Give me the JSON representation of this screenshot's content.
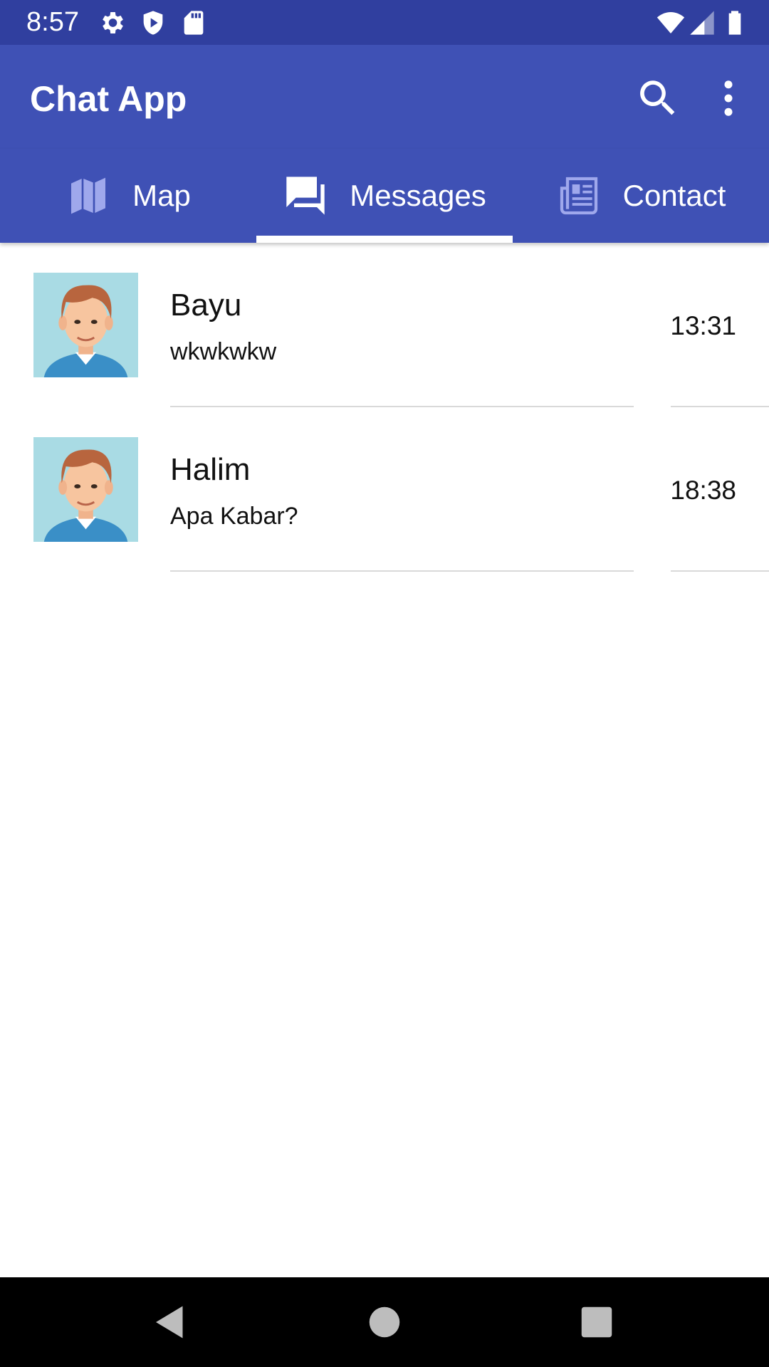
{
  "status_bar": {
    "time": "8:57",
    "icons": [
      "settings-icon",
      "shield-icon",
      "sd-card-icon",
      "wifi-icon",
      "signal-icon",
      "battery-icon"
    ]
  },
  "app_bar": {
    "title": "Chat App",
    "actions": [
      "search-icon",
      "more-vert-icon"
    ]
  },
  "tabs": [
    {
      "label": "Map",
      "icon": "map-icon",
      "selected": false
    },
    {
      "label": "Messages",
      "icon": "chat-bubbles-icon",
      "selected": true
    },
    {
      "label": "Contact",
      "icon": "newspaper-icon",
      "selected": false
    }
  ],
  "chats": [
    {
      "name": "Bayu",
      "preview": "wkwkwkw",
      "time": "13:31"
    },
    {
      "name": "Halim",
      "preview": "Apa Kabar?",
      "time": "18:38"
    }
  ],
  "nav_bar": [
    "back-icon",
    "home-icon",
    "recents-icon"
  ],
  "colors": {
    "status_bar": "#303f9f",
    "primary": "#3f51b5",
    "tab_icon_inactive": "#9fa8ec",
    "indicator": "#ffffff",
    "avatar_bg": "#a9dbe4"
  }
}
